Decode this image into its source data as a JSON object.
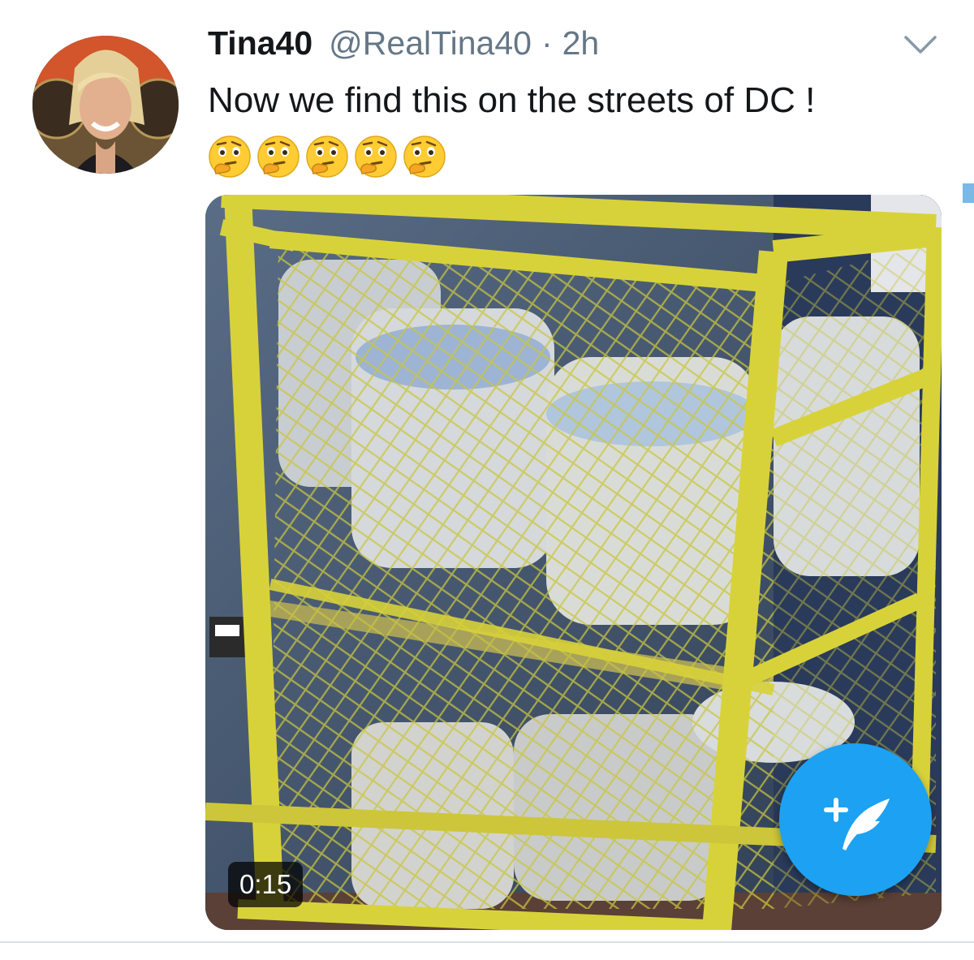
{
  "tweet": {
    "display_name": "Tina40",
    "handle": "@RealTina40",
    "separator": "·",
    "time": "2h",
    "text": "Now we find this on the streets of DC !",
    "emojis": [
      "thinking-face-emoji",
      "thinking-face-emoji",
      "thinking-face-emoji",
      "thinking-face-emoji",
      "thinking-face-emoji"
    ]
  },
  "media": {
    "type": "video",
    "duration": "0:15"
  },
  "icons": {
    "more": "chevron-down-icon",
    "compose": "compose-tweet-icon"
  },
  "colors": {
    "accent": "#1da1f2",
    "name": "#14171a",
    "secondary": "#657786",
    "divider": "#d9dfe4",
    "cage_yellow": "#d8d23a"
  }
}
